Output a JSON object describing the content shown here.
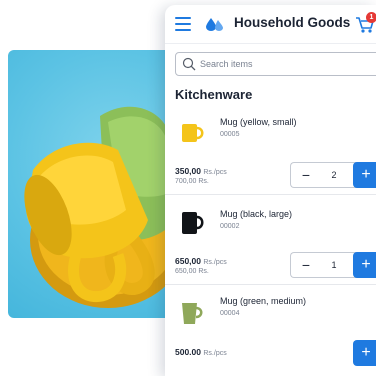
{
  "header": {
    "app_title": "Household Goods",
    "cart_count": "1",
    "icons": {
      "menu": "hamburger-menu-icon",
      "logo": "drops-logo-icon",
      "cart": "cart-icon"
    }
  },
  "search": {
    "placeholder": "Search items"
  },
  "section": {
    "title": "Kitchenware"
  },
  "products": [
    {
      "name": "Mug (yellow, small)",
      "code": "00005",
      "price": "350,00",
      "unit": "Rs./pcs",
      "old_price": "700,00 Rs.",
      "qty": "2",
      "color": "#f4c41a"
    },
    {
      "name": "Mug (black, large)",
      "code": "00002",
      "price": "650,00",
      "unit": "Rs./pcs",
      "old_price": "650,00 Rs.",
      "qty": "1",
      "color": "#111418"
    },
    {
      "name": "Mug (green, medium)",
      "code": "00004",
      "price": "500.00",
      "unit": "Rs./pcs",
      "old_price": "",
      "qty": "",
      "color": "#8fa85a"
    }
  ],
  "controls": {
    "minus": "−",
    "plus": "+"
  },
  "colors": {
    "accent": "#1f7ae0",
    "badge": "#e53935",
    "hero_bg": "#5cc3e4"
  }
}
